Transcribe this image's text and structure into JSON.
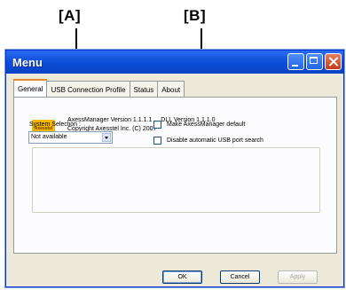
{
  "callouts": {
    "a": "[A]",
    "b": "[B]"
  },
  "window": {
    "title": "Menu"
  },
  "tabs": [
    {
      "label": "General",
      "active": true
    },
    {
      "label": "USB Connection Profile",
      "active": false
    },
    {
      "label": "Status",
      "active": false
    },
    {
      "label": "About",
      "active": false
    }
  ],
  "logo": {
    "text": "Axesstel"
  },
  "version": {
    "line1_manager": "AxessManager Version 1.1.1.1",
    "line1_dll": "DLL Version 1.1.1.0",
    "line2": "Copyright Axesstel Inc. (C) 2007"
  },
  "system_selection": {
    "label": "System Selection :",
    "value": "Not available"
  },
  "options": {
    "make_default": {
      "label": "Make AxessManager default",
      "checked": false
    },
    "disable_usb_search": {
      "label": "Disable automatic USB port search",
      "checked": false
    }
  },
  "buttons": {
    "ok": "OK",
    "cancel": "Cancel",
    "apply": "Apply"
  },
  "colors": {
    "titlebar": "#0b4bd6",
    "dialog_bg": "#ece9d8",
    "active_tab_accent": "#e68b2c",
    "logo": "#f5b800"
  }
}
